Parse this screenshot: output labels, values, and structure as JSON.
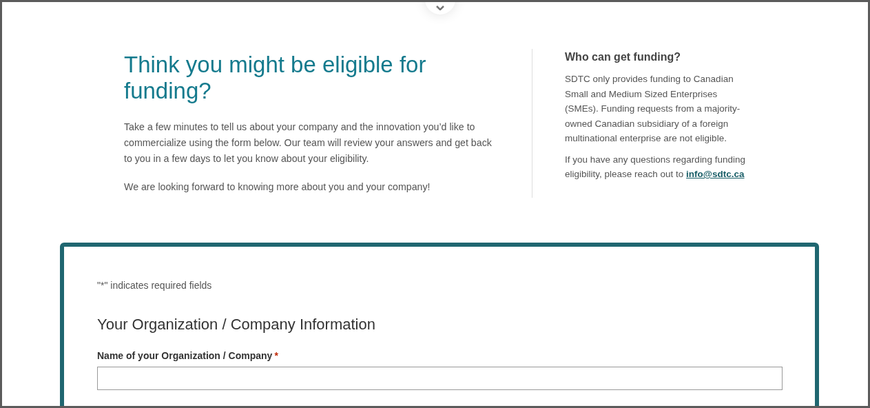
{
  "hero": {
    "heading": "Think you might be eligible for funding?",
    "paragraphs": [
      "Take a few minutes to tell us about your company and the innovation you’d like to commercialize using the form below. Our team will review your answers and get back to you in a few days to let you know about your eligibility.",
      "We are looking forward to knowing more about you and your company!"
    ]
  },
  "aside": {
    "heading": "Who can get funding?",
    "paragraph": "SDTC only provides funding to Canadian Small and Medium Sized Enterprises (SMEs). Funding requests from a majority-owned Canadian subsidiary of a foreign multinational enterprise are not eligible.",
    "contact_text": "If you have any questions regarding funding eligibility, please reach out to",
    "contact_link": "info@sdtc.ca"
  },
  "form": {
    "required_note": "\"*\" indicates required fields",
    "section_title": "Your Organization / Company Information",
    "fields": [
      {
        "label": "Name of your Organization / Company",
        "required": true,
        "required_mark": "*"
      }
    ]
  }
}
